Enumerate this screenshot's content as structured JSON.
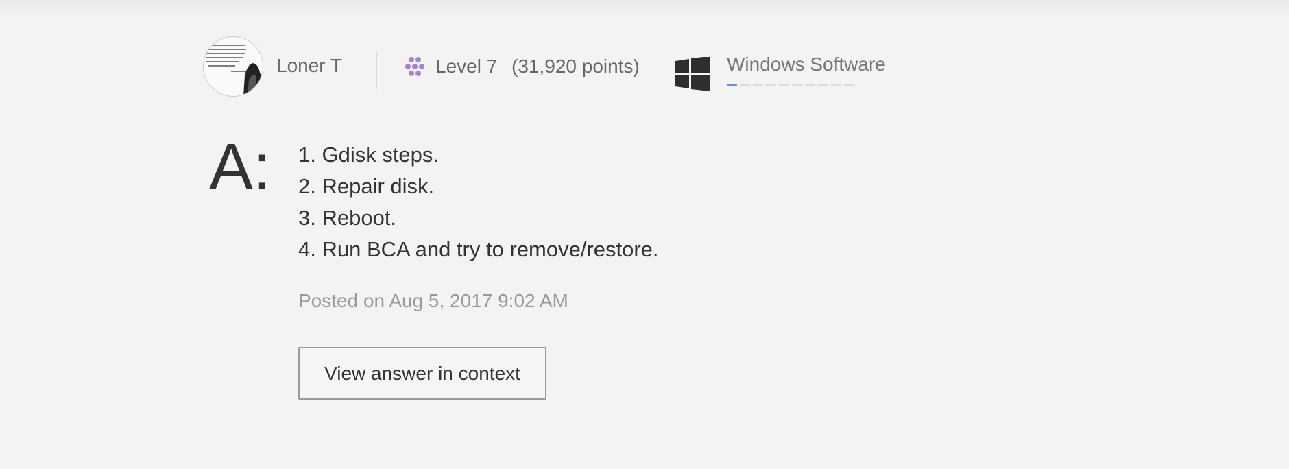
{
  "author": {
    "name": "Loner T",
    "avatar_icon": "quote-portrait-avatar",
    "level": "Level 7",
    "points": "(31,920 points)",
    "level_icon": "dots-cluster-icon",
    "level_color": "#a784c9"
  },
  "community": {
    "name": "Windows Software",
    "icon": "windows-logo-icon",
    "progress_segments": 10,
    "progress_filled": 1,
    "progress_color": "#6a8fd0"
  },
  "answer": {
    "marker": "A:",
    "steps": [
      "1. Gdisk steps.",
      "2. Repair disk.",
      "3. Reboot.",
      "4. Run BCA and try to remove/restore."
    ],
    "posted": "Posted on Aug 5, 2017 9:02 AM",
    "view_button": "View answer in context"
  }
}
